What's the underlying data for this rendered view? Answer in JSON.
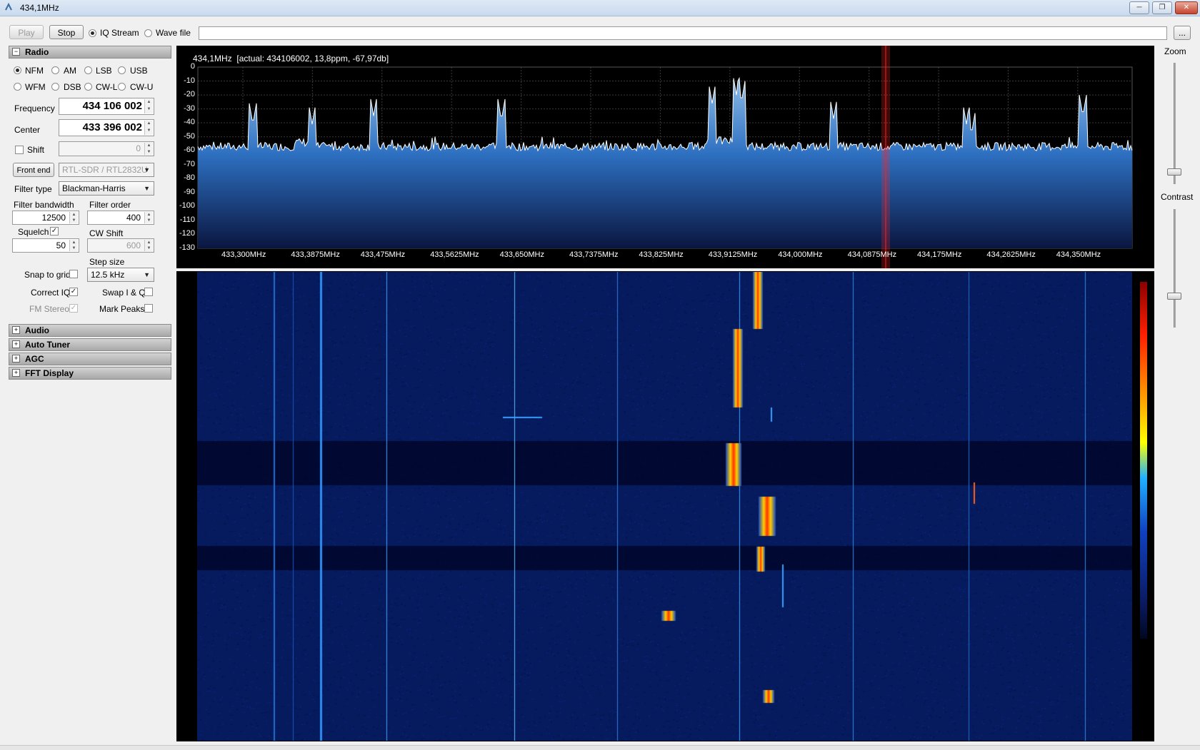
{
  "window": {
    "title": "434,1MHz",
    "minimize": "─",
    "restore": "❐",
    "close": "✕"
  },
  "toolbar": {
    "play_label": "Play",
    "stop_label": "Stop",
    "iq_stream_label": "IQ Stream",
    "wave_file_label": "Wave file",
    "source_path": "",
    "browse_label": "..."
  },
  "radio_panel": {
    "title": "Radio",
    "modes": [
      "NFM",
      "AM",
      "LSB",
      "USB",
      "WFM",
      "DSB",
      "CW-L",
      "CW-U"
    ],
    "selected_mode": "NFM",
    "frequency_label": "Frequency",
    "frequency_value": "434 106 002",
    "center_label": "Center",
    "center_value": "433 396 002",
    "shift_label": "Shift",
    "shift_value": "0",
    "front_end_label": "Front end",
    "front_end_value": "RTL-SDR / RTL2832U",
    "filter_type_label": "Filter type",
    "filter_type_value": "Blackman-Harris",
    "filter_bandwidth_label": "Filter bandwidth",
    "filter_bandwidth_value": "12500",
    "filter_order_label": "Filter order",
    "filter_order_value": "400",
    "squelch_label": "Squelch",
    "squelch_value": "50",
    "cw_shift_label": "CW Shift",
    "cw_shift_value": "600",
    "step_size_label": "Step size",
    "step_size_value": "12.5 kHz",
    "snap_to_grid_label": "Snap to grid",
    "correct_iq_label": "Correct IQ",
    "swap_iq_label": "Swap I & Q",
    "fm_stereo_label": "FM Stereo",
    "mark_peaks_label": "Mark Peaks"
  },
  "collapsed_sections": [
    "Audio",
    "Auto Tuner",
    "AGC",
    "FFT Display"
  ],
  "spectrum": {
    "header": "434,1MHz  [actual: 434106002, 13,8ppm, -67,97db]",
    "y_ticks": [
      "0",
      "-10",
      "-20",
      "-30",
      "-40",
      "-50",
      "-60",
      "-70",
      "-80",
      "-90",
      "-100",
      "-110",
      "-120",
      "-130"
    ],
    "x_ticks": [
      "433,300MHz",
      "433,3875MHz",
      "433,475MHz",
      "433,5625MHz",
      "433,650MHz",
      "433,7375MHz",
      "433,825MHz",
      "433,9125MHz",
      "434,000MHz",
      "434,0875MHz",
      "434,175MHz",
      "434,2625MHz",
      "434,350MHz"
    ],
    "colors": {
      "fill_top": "#7fb0e0",
      "fill_bottom": "#0c1c4a",
      "trace": "#ffffff",
      "tuned": "#ff2020"
    }
  },
  "right_panel": {
    "zoom_label": "Zoom",
    "contrast_label": "Contrast"
  }
}
